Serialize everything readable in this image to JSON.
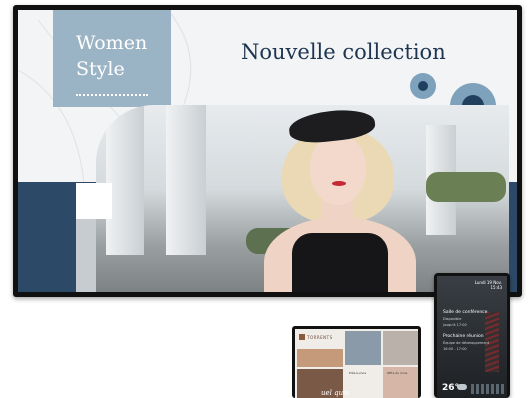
{
  "main_display": {
    "brand_line1": "Women",
    "brand_line2": "Style",
    "headline": "Nouvelle collection"
  },
  "portrait_display": {
    "date_line1": "Lundi 19 Nov.",
    "date_line2": "15:43",
    "room1_title": "Salle de conférence",
    "room1_status": "Disponible",
    "room1_time": "jusqu'à 17:00",
    "room2_title": "Prochaine réunion",
    "room2_detail": "Équipe de développement",
    "room2_time": "16:00 - 17:00",
    "temperature": "26°"
  },
  "mini_display": {
    "logo_text": "TORRENTS",
    "caption1": "Prêt-à-vivre",
    "caption2": "Offre du mois",
    "signature": "uel quis"
  },
  "colors": {
    "navy": "#2c4a68",
    "light_blue": "#9bb4c5",
    "headline": "#1e3550",
    "circle_outer": "#7ea2bb",
    "circle_inner": "#21405f"
  }
}
